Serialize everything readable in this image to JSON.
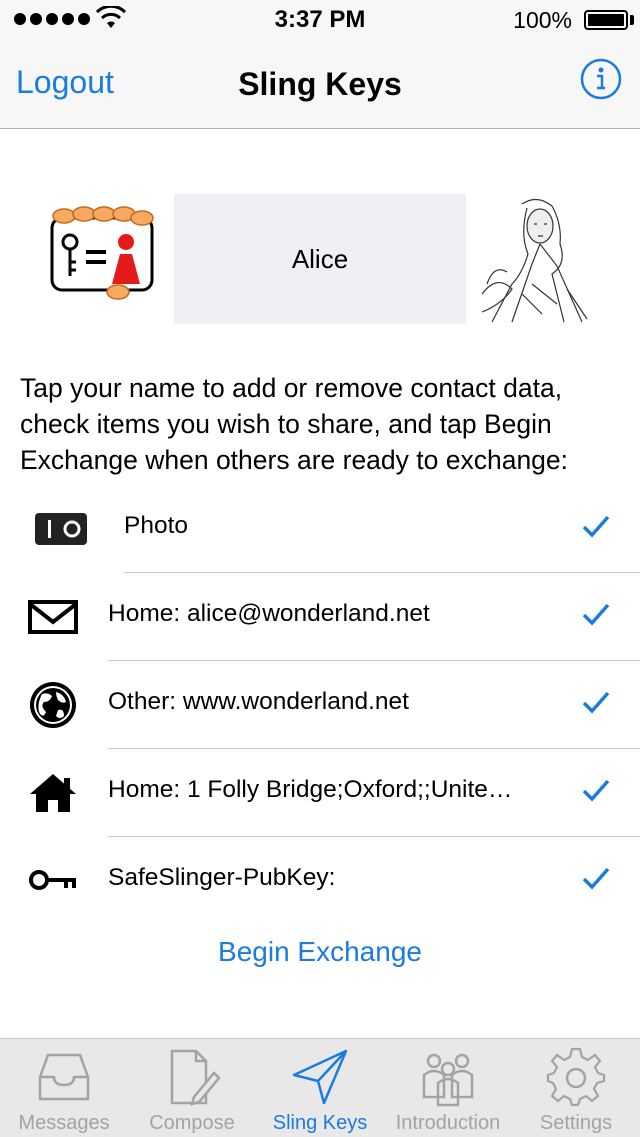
{
  "status_bar": {
    "time": "3:37 PM",
    "battery": "100%"
  },
  "nav": {
    "left_button": "Logout",
    "title": "Sling Keys",
    "info_icon": "info-circle-icon"
  },
  "profile": {
    "name": "Alice",
    "card_icon": "contact-card-key-icon",
    "photo": "alice-illustration"
  },
  "instructions": "Tap your name to add or remove contact data, check items you wish to share, and tap Begin Exchange when others are ready to exchange:",
  "items": [
    {
      "icon": "camera-icon",
      "label": "Photo",
      "checked": true
    },
    {
      "icon": "envelope-icon",
      "label": "Home: alice@wonderland.net",
      "checked": true
    },
    {
      "icon": "globe-icon",
      "label": "Other: www.wonderland.net",
      "checked": true
    },
    {
      "icon": "house-icon",
      "label": "Home: 1 Folly Bridge;Oxford;;Unite…",
      "checked": true
    },
    {
      "icon": "key-icon",
      "label": "SafeSlinger-PubKey:",
      "checked": true
    }
  ],
  "begin_exchange": "Begin Exchange",
  "tabs": [
    {
      "label": "Messages",
      "icon": "inbox-tray-icon",
      "active": false
    },
    {
      "label": "Compose",
      "icon": "compose-pencil-icon",
      "active": false
    },
    {
      "label": "Sling Keys",
      "icon": "paper-plane-icon",
      "active": true
    },
    {
      "label": "Introduction",
      "icon": "people-group-icon",
      "active": false
    },
    {
      "label": "Settings",
      "icon": "gear-icon",
      "active": false
    }
  ],
  "colors": {
    "accent": "#1a7be0",
    "inactive_tab": "#a3a3a3",
    "name_box": "#efeff4",
    "bars": "#f7f7f7"
  }
}
